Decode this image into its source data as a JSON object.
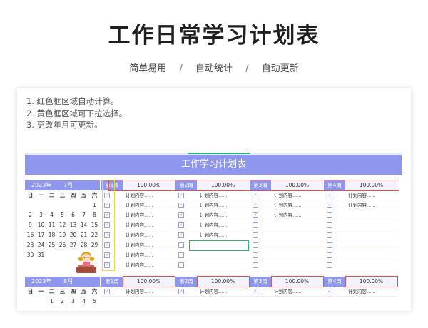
{
  "hero_title": "工作日常学习计划表",
  "subtitle": {
    "items": [
      "简单易用",
      "自动统计",
      "自动更新"
    ],
    "separator": "/"
  },
  "notes": [
    "1. 红色框区域自动计算。",
    "2. 黄色框区域可下拉选择。",
    "3. 更改年月可更新。"
  ],
  "banner_title": "工作学习计划表",
  "weekdays": [
    "日",
    "一",
    "二",
    "三",
    "四",
    "五",
    "六"
  ],
  "months": [
    {
      "year": "2023年",
      "month": "7月",
      "calendar": [
        [
          "",
          "",
          "",
          "",
          "",
          "",
          "1"
        ],
        [
          "2",
          "3",
          "4",
          "5",
          "6",
          "7",
          "8"
        ],
        [
          "9",
          "10",
          "11",
          "12",
          "13",
          "14",
          "15"
        ],
        [
          "16",
          "17",
          "18",
          "19",
          "20",
          "21",
          "22"
        ],
        [
          "23",
          "24",
          "25",
          "26",
          "27",
          "28",
          "29"
        ],
        [
          "30",
          "31",
          "",
          "",
          "",
          "",
          ""
        ]
      ],
      "weeks": [
        {
          "label": "第1周",
          "percent": "100.00%",
          "rows": [
            {
              "checked": true,
              "text": "计划内容......"
            },
            {
              "checked": true,
              "text": "计划内容......"
            },
            {
              "checked": true,
              "text": "计划内容......"
            },
            {
              "checked": true,
              "text": "计划内容......"
            },
            {
              "checked": true,
              "text": "计划内容......"
            },
            {
              "checked": true,
              "text": "计划内容......"
            },
            {
              "checked": true,
              "text": "计划内容......"
            },
            {
              "checked": true,
              "text": "计划内容......"
            }
          ]
        },
        {
          "label": "第2周",
          "percent": "100.00%",
          "rows": [
            {
              "checked": true,
              "text": "计划内容......"
            },
            {
              "checked": true,
              "text": "计划内容......"
            },
            {
              "checked": true,
              "text": "计划内容......"
            },
            {
              "checked": true,
              "text": "计划内容......"
            },
            {
              "checked": true,
              "text": "计划内容......"
            },
            {
              "checked": false,
              "text": ""
            },
            {
              "checked": false,
              "text": ""
            },
            {
              "checked": false,
              "text": ""
            }
          ]
        },
        {
          "label": "第3周",
          "percent": "100.00%",
          "rows": [
            {
              "checked": true,
              "text": "计划内容......"
            },
            {
              "checked": true,
              "text": "计划内容......"
            },
            {
              "checked": true,
              "text": "计划内容......"
            },
            {
              "checked": false,
              "text": ""
            },
            {
              "checked": false,
              "text": ""
            },
            {
              "checked": false,
              "text": ""
            },
            {
              "checked": false,
              "text": ""
            },
            {
              "checked": false,
              "text": ""
            }
          ]
        },
        {
          "label": "第4周",
          "percent": "100.00%",
          "rows": [
            {
              "checked": true,
              "text": "计划内容......"
            },
            {
              "checked": true,
              "text": "计划内容......"
            },
            {
              "checked": false,
              "text": ""
            },
            {
              "checked": false,
              "text": ""
            },
            {
              "checked": false,
              "text": ""
            },
            {
              "checked": false,
              "text": ""
            },
            {
              "checked": false,
              "text": ""
            },
            {
              "checked": false,
              "text": ""
            }
          ]
        }
      ]
    },
    {
      "year": "2023年",
      "month": "8月",
      "calendar": [
        [
          "",
          "",
          "1",
          "2",
          "3",
          "4",
          "5"
        ]
      ],
      "weeks": [
        {
          "label": "第1周",
          "percent": "100.00%",
          "rows": [
            {
              "checked": true,
              "text": "计划内容......"
            }
          ]
        },
        {
          "label": "第2周",
          "percent": "100.00%",
          "rows": [
            {
              "checked": true,
              "text": "计划内容......"
            }
          ]
        },
        {
          "label": "第3周",
          "percent": "100.00%",
          "rows": [
            {
              "checked": true,
              "text": "计划内容......"
            }
          ]
        },
        {
          "label": "第4周",
          "percent": "100.00%",
          "rows": [
            {
              "checked": true,
              "text": "计划内容......"
            }
          ]
        }
      ]
    }
  ],
  "colors": {
    "accent": "#8f96ee",
    "red_box": "#d9534f",
    "yellow_box": "#f0d53a",
    "green_box": "#2cb36b"
  },
  "icons": {
    "check": "check-icon",
    "mascot": "mascot-illustration"
  }
}
